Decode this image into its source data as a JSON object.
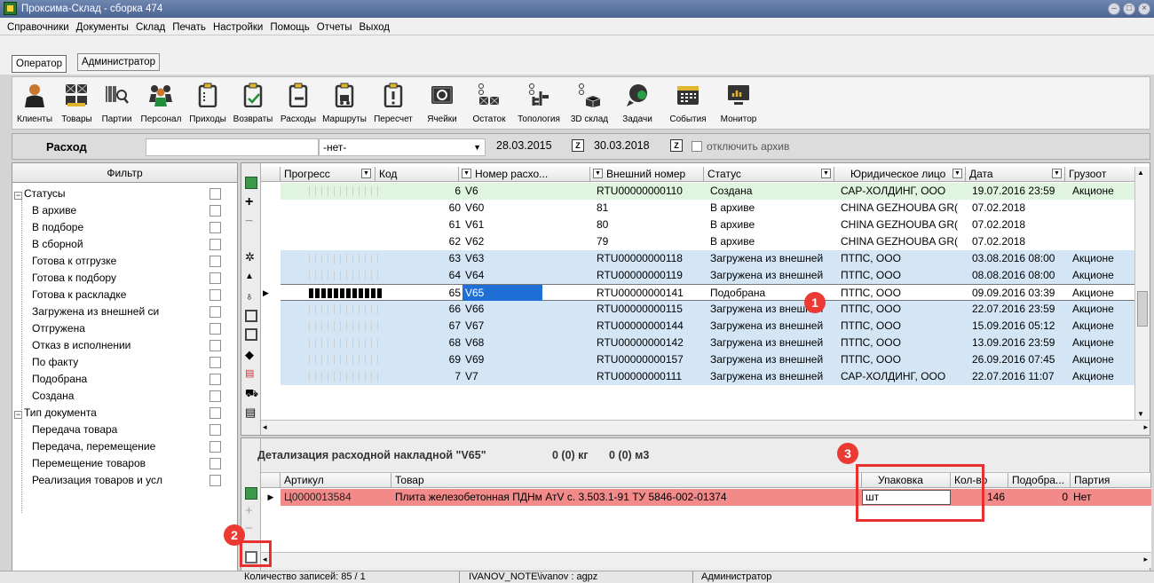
{
  "window": {
    "title": "Проксима-Склад - сборка 474"
  },
  "menu": [
    "Справочники",
    "Документы",
    "Склад",
    "Печать",
    "Настройки",
    "Помощь",
    "Отчеты",
    "Выход"
  ],
  "role_tabs": [
    {
      "label": "Оператор",
      "active": true
    },
    {
      "label": "Администратор",
      "active": false
    }
  ],
  "toolbar": [
    {
      "label": "Клиенты",
      "icon": "person-icon"
    },
    {
      "label": "Товары",
      "icon": "boxes-icon"
    },
    {
      "label": "Партии",
      "icon": "barcode-search-icon"
    },
    {
      "label": "Персонал",
      "icon": "staff-icon"
    },
    {
      "label": "Приходы",
      "icon": "clipboard-icon"
    },
    {
      "label": "Возвраты",
      "icon": "clipboard-check-icon"
    },
    {
      "label": "Расходы",
      "icon": "clipboard-minus-icon"
    },
    {
      "label": "Маршруты",
      "icon": "clipboard-truck-icon"
    },
    {
      "label": "Пересчет",
      "icon": "clipboard-alert-icon"
    },
    {
      "label": "Ячейки",
      "icon": "cell-icon"
    },
    {
      "label": "Остаток",
      "icon": "stock-icon"
    },
    {
      "label": "Топология",
      "icon": "topology-icon"
    },
    {
      "label": "3D склад",
      "icon": "warehouse-3d-icon"
    },
    {
      "label": "Задачи",
      "icon": "tasks-icon"
    },
    {
      "label": "События",
      "icon": "calendar-icon"
    },
    {
      "label": "Монитор",
      "icon": "monitor-chart-icon"
    }
  ],
  "filterbar": {
    "doc_type": "Расход",
    "search_value": "",
    "select_value": "-нет-",
    "date_from": "28.03.2015",
    "date_to": "30.03.2018",
    "archive_label": "отключить архив"
  },
  "filter": {
    "title": "Фильтр",
    "groups": [
      {
        "label": "Статусы",
        "items": [
          "В архиве",
          "В подборе",
          "В сборной",
          "Готова к отгрузке",
          "Готова к подбору",
          "Готова к раскладке",
          "Загружена из внешней си",
          "Отгружена",
          "Отказ в исполнении",
          "По факту",
          "Подобрана",
          "Создана"
        ]
      },
      {
        "label": "Тип документа",
        "items": [
          "Передача товара",
          "Передача, перемещение",
          "Перемещение товаров",
          "Реализация товаров и усл"
        ]
      }
    ]
  },
  "grid": {
    "columns": [
      "Прогресс",
      "Код",
      "Номер расхо...",
      "Внешний номер",
      "Статус",
      "Юридическое лицо",
      "Дата",
      "Грузоот"
    ],
    "rows": [
      {
        "code": "6",
        "number": "V6",
        "ext": "RTU00000000110",
        "status": "Создана",
        "entity": "САР-ХОЛДИНГ, ООО",
        "date": "19.07.2016 23:59",
        "shipper": "Акционе",
        "color": "#dff5df",
        "progress": "empty"
      },
      {
        "code": "60",
        "number": "V60",
        "ext": "81",
        "status": "В архиве",
        "entity": "CHINA GEZHOUBA GR(",
        "date": "07.02.2018",
        "shipper": "",
        "color": "#ffffff",
        "progress": "none"
      },
      {
        "code": "61",
        "number": "V61",
        "ext": "80",
        "status": "В архиве",
        "entity": "CHINA GEZHOUBA GR(",
        "date": "07.02.2018",
        "shipper": "",
        "color": "#ffffff",
        "progress": "none"
      },
      {
        "code": "62",
        "number": "V62",
        "ext": "79",
        "status": "В архиве",
        "entity": "CHINA GEZHOUBA GR(",
        "date": "07.02.2018",
        "shipper": "",
        "color": "#ffffff",
        "progress": "none"
      },
      {
        "code": "63",
        "number": "V63",
        "ext": "RTU00000000118",
        "status": "Загружена из внешней",
        "entity": "ПТПС, ООО",
        "date": "03.08.2016 08:00",
        "shipper": "Акционе",
        "color": "#d4e6f6",
        "progress": "empty"
      },
      {
        "code": "64",
        "number": "V64",
        "ext": "RTU00000000119",
        "status": "Загружена из внешней",
        "entity": "ПТПС, ООО",
        "date": "08.08.2016 08:00",
        "shipper": "Акционе",
        "color": "#d4e6f6",
        "progress": "empty"
      },
      {
        "code": "65",
        "number": "V65",
        "ext": "RTU00000000141",
        "status": "Подобрана",
        "entity": "ПТПС, ООО",
        "date": "09.09.2016 03:39",
        "shipper": "Акционе",
        "color": "#ffffff",
        "progress": "full",
        "selected": true
      },
      {
        "code": "66",
        "number": "V66",
        "ext": "RTU00000000115",
        "status": "Загружена из внешней",
        "entity": "ПТПС, ООО",
        "date": "22.07.2016 23:59",
        "shipper": "Акционе",
        "color": "#d4e6f6",
        "progress": "empty"
      },
      {
        "code": "67",
        "number": "V67",
        "ext": "RTU00000000144",
        "status": "Загружена из внешней",
        "entity": "ПТПС, ООО",
        "date": "15.09.2016 05:12",
        "shipper": "Акционе",
        "color": "#d4e6f6",
        "progress": "empty"
      },
      {
        "code": "68",
        "number": "V68",
        "ext": "RTU00000000142",
        "status": "Загружена из внешней",
        "entity": "ПТПС, ООО",
        "date": "13.09.2016 23:59",
        "shipper": "Акционе",
        "color": "#d4e6f6",
        "progress": "empty"
      },
      {
        "code": "69",
        "number": "V69",
        "ext": "RTU00000000157",
        "status": "Загружена из внешней",
        "entity": "ПТПС, ООО",
        "date": "26.09.2016 07:45",
        "shipper": "Акционе",
        "color": "#d4e6f6",
        "progress": "empty"
      },
      {
        "code": "7",
        "number": "V7",
        "ext": "RTU00000000111",
        "status": "Загружена из внешней",
        "entity": "САР-ХОЛДИНГ, ООО",
        "date": "22.07.2016 11:07",
        "shipper": "Акционе",
        "color": "#d4e6f6",
        "progress": "empty"
      }
    ]
  },
  "details": {
    "title": "Детализация расходной накладной \"V65\"",
    "weight": "0 (0) кг",
    "volume": "0 (0) м3",
    "columns": [
      "Артикул",
      "Товар",
      "Упаковка",
      "Кол-во",
      "Подобра...",
      "Партия"
    ],
    "row": {
      "article": "Ц0000013584",
      "product": "Плита железобетонная ПДНм АтV с. 3.503.1-91 ТУ 5846-002-01374",
      "pack": "шт",
      "qty": "146",
      "picked": "0",
      "batch": "Нет"
    }
  },
  "statusbar": {
    "records": "Количество записей: 85 / 1",
    "user": "IVANOV_NOTE\\ivanov : agpz",
    "role": "Администратор"
  },
  "annotations": [
    "1",
    "2",
    "3"
  ],
  "colors": {
    "accent_red": "#e8312f",
    "selected_cell": "#1f6fd6",
    "row_blue": "#d4e6f6",
    "row_green": "#dff5df",
    "detail_row": "#f28a8a"
  }
}
